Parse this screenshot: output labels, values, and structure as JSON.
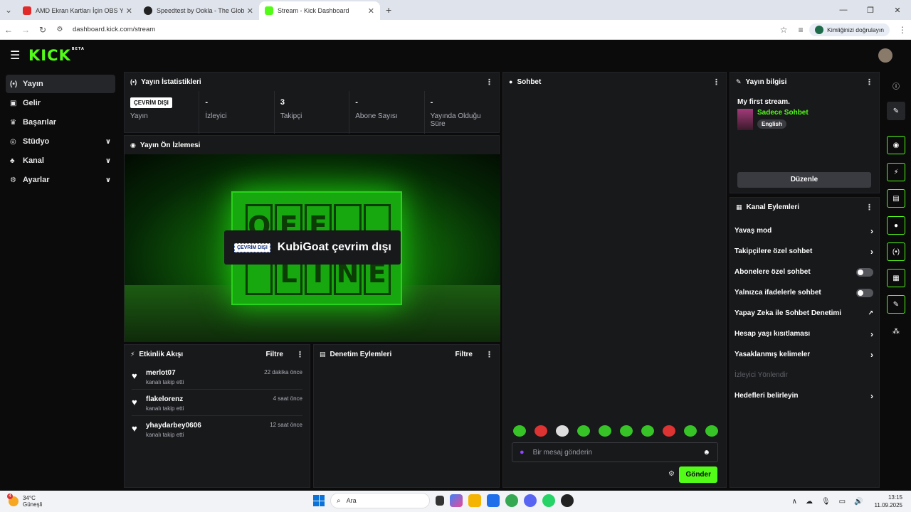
{
  "browser": {
    "tabs": [
      {
        "title": "AMD Ekran Kartları İçin OBS Ya",
        "favicon_color": "#e12b2b"
      },
      {
        "title": "Speedtest by Ookla - The Globa",
        "favicon_color": "#222222"
      },
      {
        "title": "Stream - Kick Dashboard",
        "favicon_color": "#53fc18"
      }
    ],
    "url": "dashboard.kick.com/stream",
    "verify_label": "Kimliğinizi doğrulayın"
  },
  "app": {
    "logo": "KICK",
    "logo_badge": "BETA",
    "accent": "#53fc18"
  },
  "sidebar": {
    "items": [
      {
        "label": "Yayın",
        "icon": "broadcast-icon"
      },
      {
        "label": "Gelir",
        "icon": "wallet-icon"
      },
      {
        "label": "Başarılar",
        "icon": "trophy-icon"
      },
      {
        "label": "Stüdyo",
        "icon": "studio-icon"
      },
      {
        "label": "Kanal",
        "icon": "channel-icon"
      },
      {
        "label": "Ayarlar",
        "icon": "gear-icon"
      }
    ]
  },
  "stats": {
    "title": "Yayın İstatistikleri",
    "status_badge": "ÇEVRİM DIŞI",
    "items": [
      {
        "label": "Yayın"
      },
      {
        "value": "-",
        "label": "İzleyici"
      },
      {
        "value": "3",
        "label": "Takipçi"
      },
      {
        "value": "-",
        "label": "Abone Sayısı"
      },
      {
        "value": "-",
        "label": "Yayında Olduğu Süre"
      }
    ]
  },
  "preview": {
    "title": "Yayın Ön İzlemesi",
    "sign_letters": [
      "O",
      "F",
      "F",
      "",
      "",
      "",
      "L",
      "I",
      "N",
      "E"
    ],
    "offline_badge": "ÇEVRİM DIŞI",
    "offline_text": "KubiGoat çevrim dışı"
  },
  "feed": {
    "title": "Etkinlik Akışı",
    "filter": "Filtre",
    "events": [
      {
        "name": "merlot07",
        "action": "kanalı takip etti",
        "time": "22 dakika önce"
      },
      {
        "name": "flakelorenz",
        "action": "kanalı takip etti",
        "time": "4 saat önce"
      },
      {
        "name": "yhaydarbey0606",
        "action": "kanalı takip etti",
        "time": "12 saat önce"
      }
    ]
  },
  "moderation": {
    "title": "Denetim Eylemleri",
    "filter": "Filtre"
  },
  "chat": {
    "title": "Sohbet",
    "placeholder": "Bir mesaj gönderin",
    "send": "Gönder"
  },
  "stream_info": {
    "title": "Yayın bilgisi",
    "stream_title": "My first stream.",
    "category": "Sadece Sohbet",
    "language": "English",
    "edit": "Düzenle"
  },
  "channel_actions": {
    "title": "Kanal Eylemleri",
    "items": [
      {
        "label": "Yavaş mod",
        "control": "chevron"
      },
      {
        "label": "Takipçilere özel sohbet",
        "control": "chevron"
      },
      {
        "label": "Abonelere özel sohbet",
        "control": "toggle",
        "on": false
      },
      {
        "label": "Yalnızca ifadelerle sohbet",
        "control": "toggle",
        "on": false
      },
      {
        "label": "Yapay Zeka ile Sohbet Denetimi",
        "control": "external"
      },
      {
        "label": "Hesap yaşı kısıtlaması",
        "control": "chevron"
      },
      {
        "label": "Yasaklanmış kelimeler",
        "control": "chevron"
      },
      {
        "label": "İzleyici Yönlendir",
        "control": "none",
        "disabled": true
      },
      {
        "label": "Hedefleri belirleyin",
        "control": "chevron"
      }
    ]
  },
  "taskbar": {
    "temperature": "34°C",
    "weather": "Güneşli",
    "weather_badge": "4",
    "search": "Ara",
    "time": "13:15",
    "date": "11.09.2025"
  }
}
